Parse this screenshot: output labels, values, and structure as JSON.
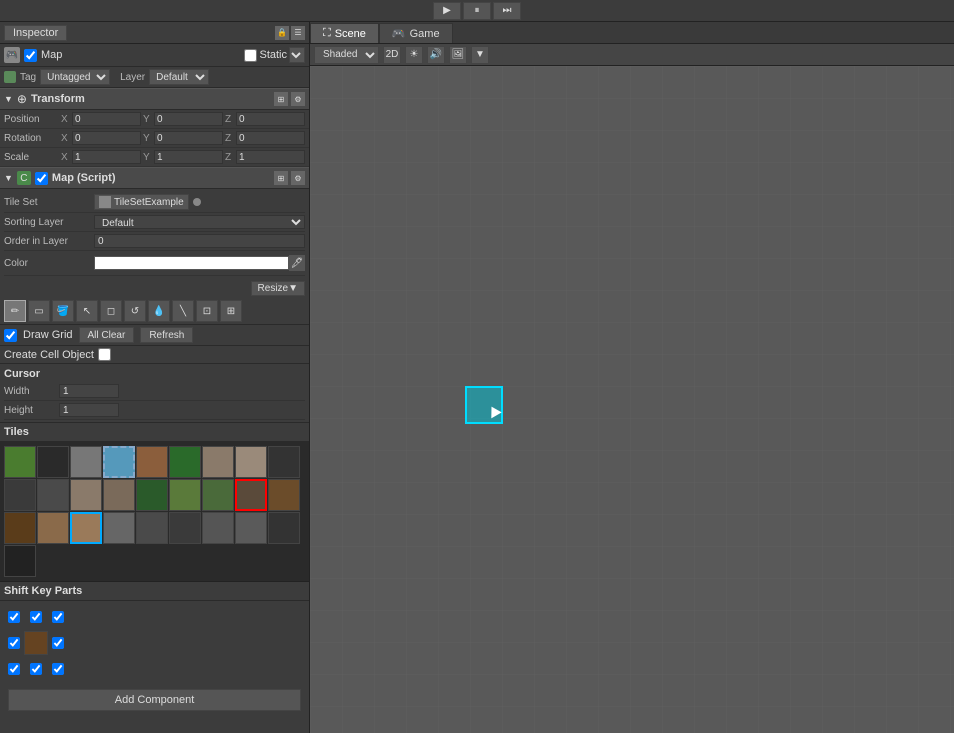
{
  "toolbar": {
    "play_label": "▶",
    "pause_label": "⏸",
    "step_label": "⏭"
  },
  "inspector": {
    "tab_label": "Inspector",
    "object_name": "Map",
    "static_label": "Static",
    "tag_label": "Tag",
    "tag_value": "Untagged",
    "layer_label": "Layer",
    "layer_value": "Default",
    "transform": {
      "title": "Transform",
      "position_label": "Position",
      "rotation_label": "Rotation",
      "scale_label": "Scale",
      "pos_x": "0",
      "pos_y": "0",
      "pos_z": "0",
      "rot_x": "0",
      "rot_y": "0",
      "rot_z": "0",
      "scale_x": "1",
      "scale_y": "1",
      "scale_z": "1"
    },
    "map_script": {
      "title": "Map (Script)",
      "tile_set_label": "Tile Set",
      "tile_set_value": "TileSetExample",
      "sorting_layer_label": "Sorting Layer",
      "sorting_layer_value": "Default",
      "order_in_layer_label": "Order in Layer",
      "order_in_layer_value": "0",
      "color_label": "Color",
      "resize_btn": "Resize▼"
    },
    "tools": {
      "draw_grid_label": "Draw Grid",
      "all_clear_btn": "All Clear",
      "refresh_btn": "Refresh",
      "create_cell_label": "Create Cell Object"
    },
    "cursor": {
      "title": "Cursor",
      "width_label": "Width",
      "width_value": "1",
      "height_label": "Height",
      "height_value": "1"
    },
    "tiles": {
      "title": "Tiles"
    },
    "shift_key": {
      "title": "Shift Key Parts"
    },
    "add_component_btn": "Add Component"
  },
  "scene": {
    "tab_label": "Scene",
    "game_tab_label": "Game",
    "shading_value": "Shaded",
    "mode_2d_label": "2D"
  }
}
